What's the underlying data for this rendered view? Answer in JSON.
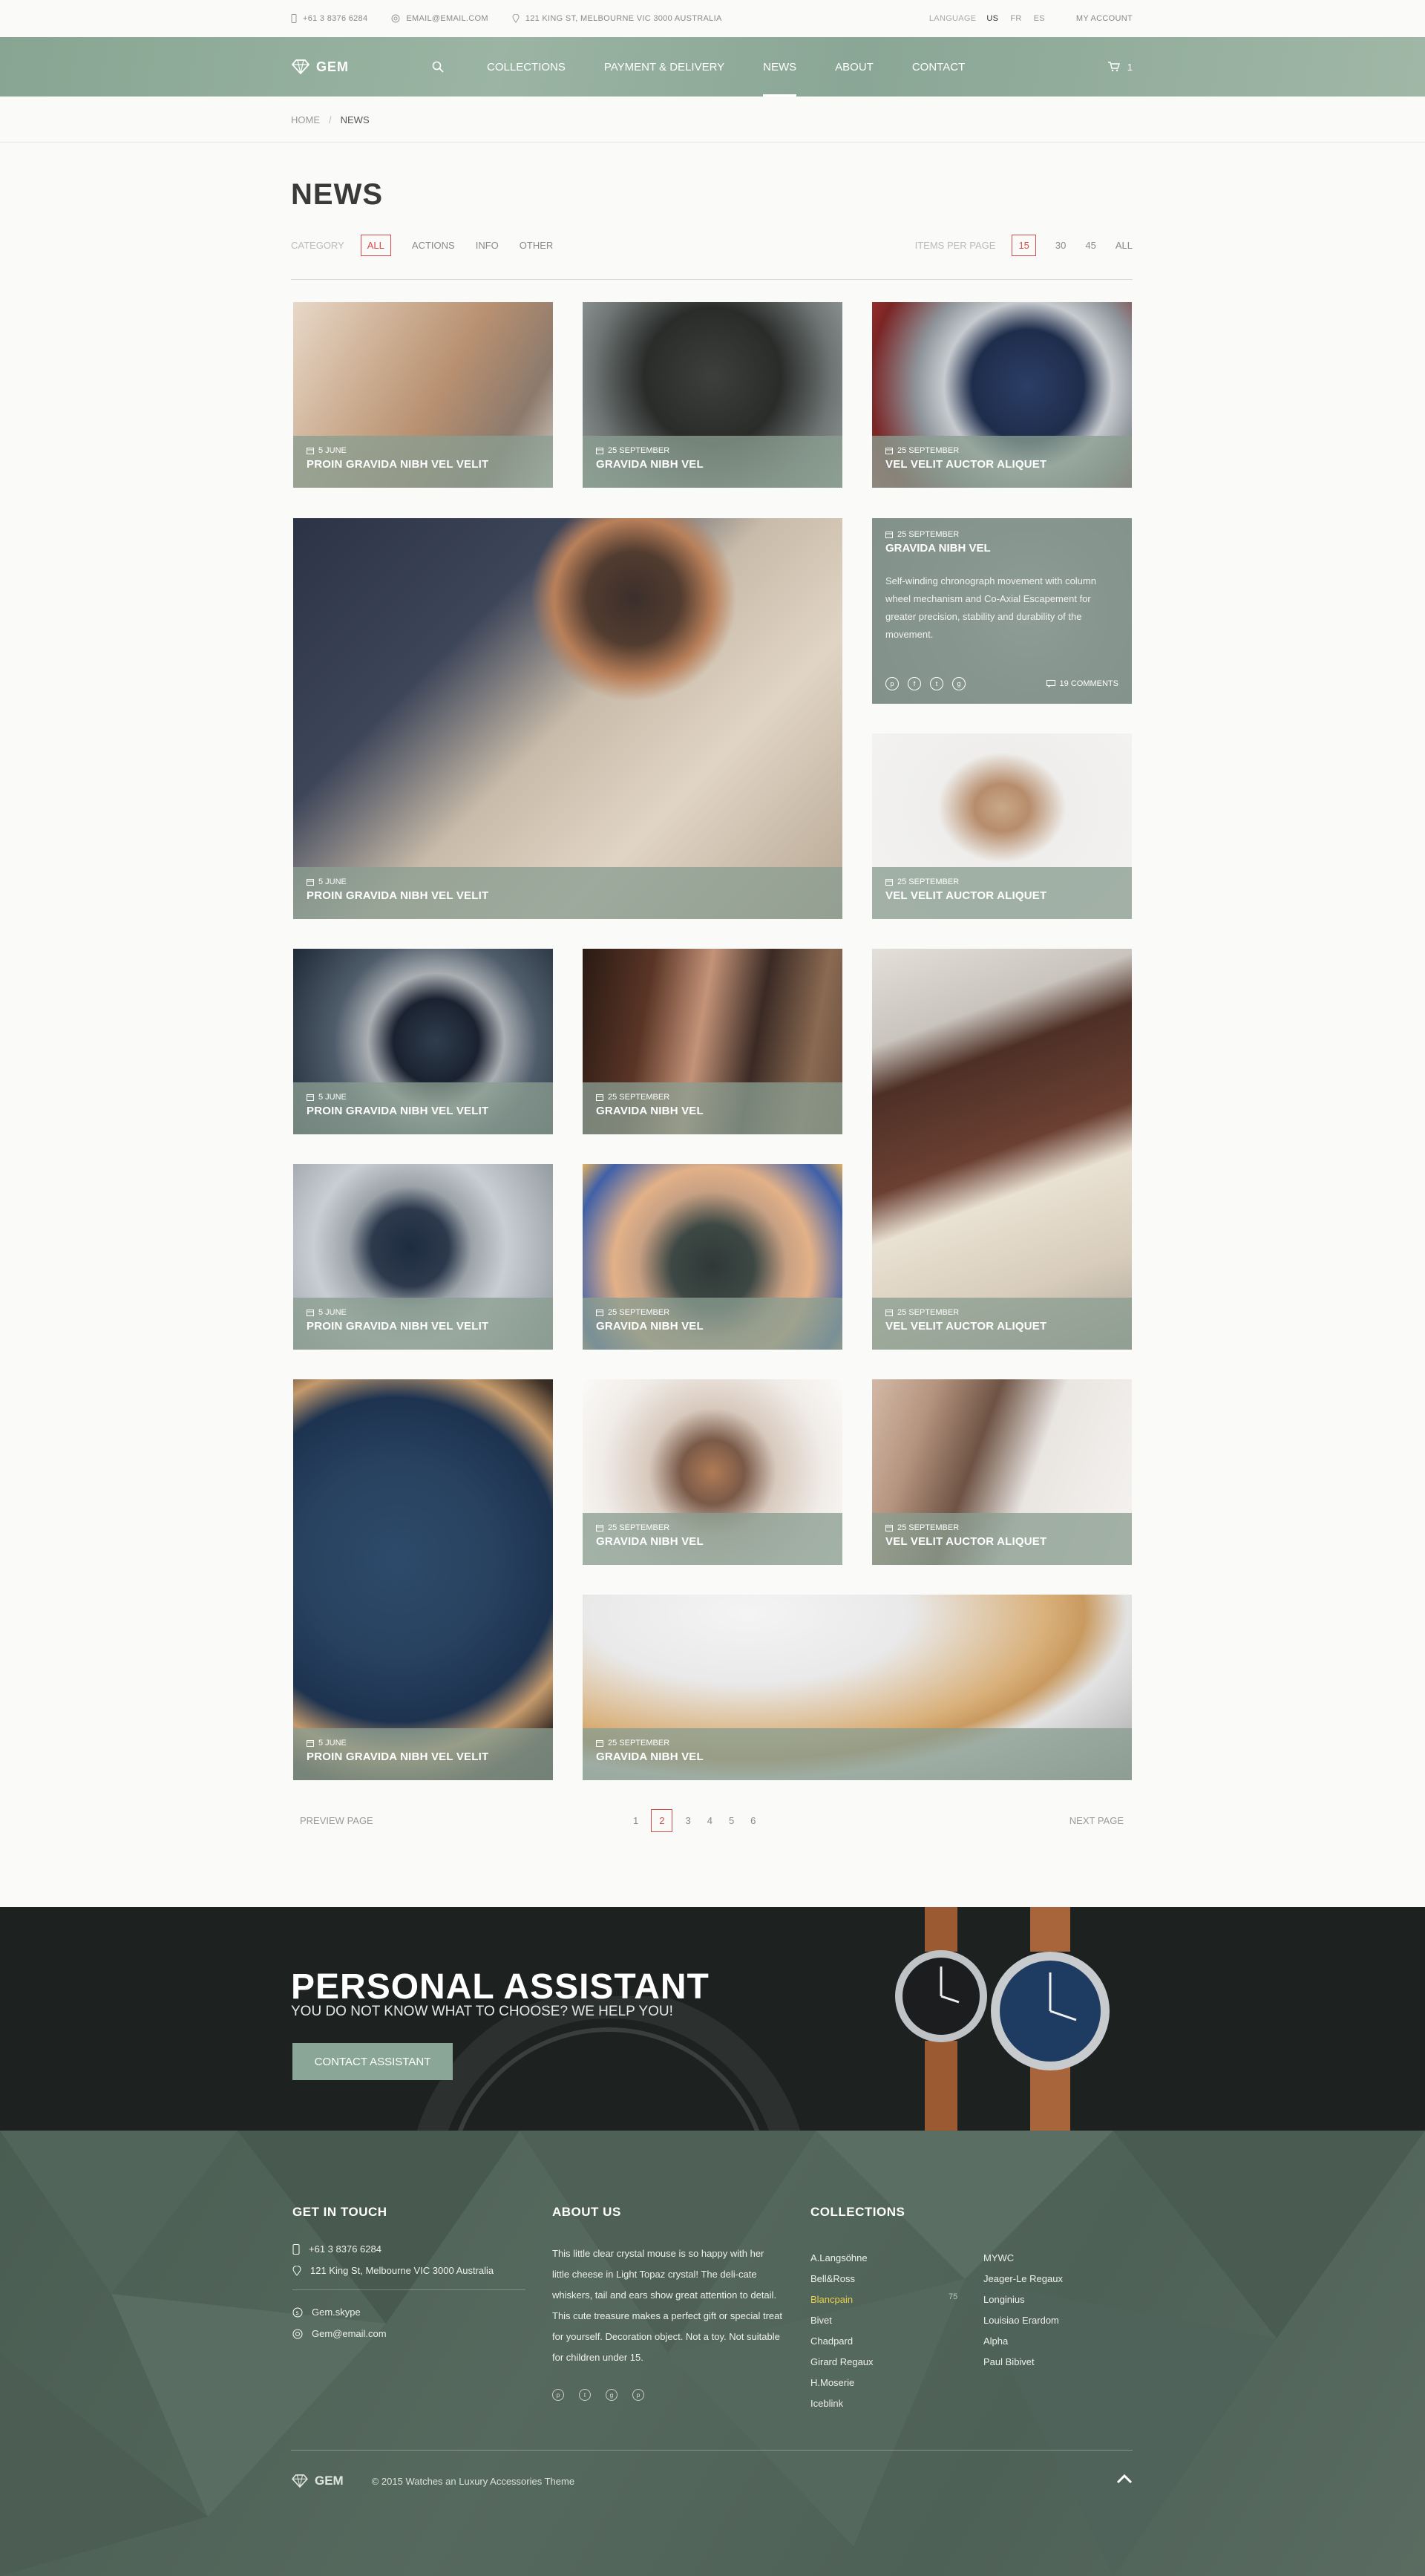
{
  "topbar": {
    "phone": "+61 3 8376 6284",
    "email": "EMAIL@EMAIL.COM",
    "address": "121 KING ST, MELBOURNE VIC 3000 AUSTRALIA",
    "language_label": "LANGUAGE",
    "languages": [
      "US",
      "FR",
      "ES"
    ],
    "account": "MY ACCOUNT"
  },
  "nav": {
    "logo": "GEM",
    "items": [
      "COLLECTIONS",
      "PAYMENT & DELIVERY",
      "NEWS",
      "ABOUT",
      "CONTACT"
    ],
    "active": "NEWS",
    "cart_count": "1"
  },
  "breadcrumb": {
    "home": "HOME",
    "sep": "/",
    "current": "NEWS"
  },
  "page": {
    "title": "NEWS"
  },
  "filters": {
    "label": "CATEGORY",
    "items": [
      "ALL",
      "ACTIONS",
      "INFO",
      "OTHER"
    ],
    "per_page_label": "ITEMS PER PAGE",
    "per_page": [
      "15",
      "30",
      "45",
      "ALL"
    ]
  },
  "cards": [
    {
      "date": "5 JUNE",
      "title": "PROIN GRAVIDA NIBH VEL VELIT"
    },
    {
      "date": "25 SEPTEMBER",
      "title": "GRAVIDA NIBH VEL"
    },
    {
      "date": "25 SEPTEMBER",
      "title": "VEL VELIT AUCTOR ALIQUET"
    },
    {
      "date": "5 JUNE",
      "title": "PROIN GRAVIDA NIBH VEL VELIT"
    },
    {
      "date": "25 SEPTEMBER",
      "title": "VEL VELIT AUCTOR ALIQUET"
    },
    {
      "date": "5 JUNE",
      "title": "PROIN GRAVIDA NIBH VEL VELIT"
    },
    {
      "date": "25 SEPTEMBER",
      "title": "GRAVIDA NIBH VEL"
    },
    {
      "date": "25 SEPTEMBER",
      "title": "VEL VELIT AUCTOR ALIQUET"
    },
    {
      "date": "5 JUNE",
      "title": "PROIN GRAVIDA NIBH VEL VELIT"
    },
    {
      "date": "25 SEPTEMBER",
      "title": "GRAVIDA NIBH VEL"
    },
    {
      "date": "5 JUNE",
      "title": "PROIN GRAVIDA NIBH VEL VELIT"
    },
    {
      "date": "25 SEPTEMBER",
      "title": "GRAVIDA NIBH VEL"
    },
    {
      "date": "25 SEPTEMBER",
      "title": "VEL VELIT AUCTOR ALIQUET"
    },
    {
      "date": "25 SEPTEMBER",
      "title": "GRAVIDA NIBH VEL"
    }
  ],
  "featured": {
    "date": "25 SEPTEMBER",
    "title": "GRAVIDA NIBH VEL",
    "desc": "Self-winding chronograph movement with column wheel mechanism and Co-Axial Escapement for greater precision, stability and durability of the movement.",
    "comments": "19 COMMENTS"
  },
  "pagination": {
    "prev": "PREVIEW PAGE",
    "next": "NEXT PAGE",
    "pages": [
      "1",
      "2",
      "3",
      "4",
      "5",
      "6"
    ],
    "current": "2"
  },
  "assistant": {
    "title": "PERSONAL ASSISTANT",
    "subtitle": "YOU DO NOT KNOW WHAT TO CHOOSE? WE HELP YOU!",
    "button": "CONTACT ASSISTANT"
  },
  "footer": {
    "contact": {
      "heading": "GET IN TOUCH",
      "phone": "+61 3 8376 6284",
      "address": "121 King St, Melbourne VIC 3000 Australia",
      "skype": "Gem.skype",
      "email": "Gem@email.com"
    },
    "about": {
      "heading": "ABOUT US",
      "text": "This little clear crystal mouse is so happy with her little cheese in Light Topaz crystal! The deli-cate whiskers, tail and ears show great attention to detail. This cute treasure makes a perfect gift or special treat for yourself. Decoration object. Not a toy. Not suitable for children under 15."
    },
    "collections": {
      "heading": "COLLECTIONS",
      "col1": [
        "A.Langsöhne",
        "Bell&Ross",
        "Blancpain",
        "Bivet",
        "Chadpard",
        "Girard Regaux",
        "H.Moserie",
        "Iceblink"
      ],
      "col2": [
        "MYWC",
        "Jeager-Le Regaux",
        "Longinius",
        "Louisiao Erardom",
        "Alpha",
        "Paul Bibivet"
      ],
      "highlight_count": "75"
    },
    "logo": "GEM",
    "copyright": "© 2015 Watches an Luxury Accessories Theme"
  },
  "colors": {
    "accent": "#d64a4a",
    "brand_green": "#8aa697",
    "dark": "#1d2120",
    "footer_green": "#4e6157"
  }
}
